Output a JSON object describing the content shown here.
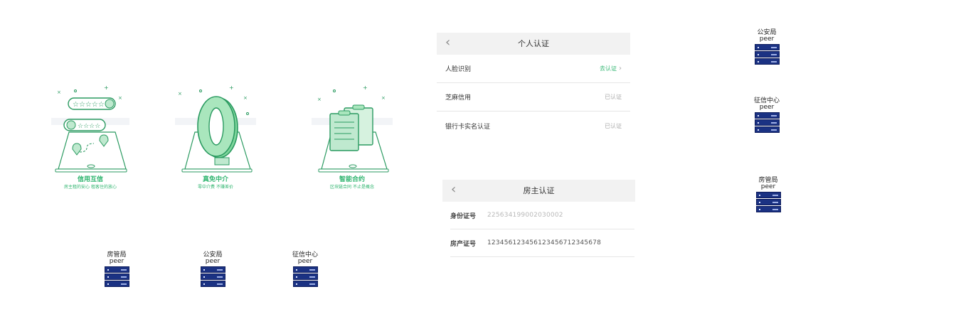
{
  "onboarding": [
    {
      "title": "信用互信",
      "subtitle": "房主租的安心    租客住的放心"
    },
    {
      "title": "真免中介",
      "subtitle": "零中介费    不赚差价"
    },
    {
      "title": "智能合约",
      "subtitle": "区块链合同    不止是概念"
    }
  ],
  "peers_row": [
    {
      "name": "房管局",
      "label": "peer"
    },
    {
      "name": "公安局",
      "label": "peer"
    },
    {
      "name": "征信中心",
      "label": "peer"
    }
  ],
  "peers_column": [
    {
      "name": "公安局",
      "label": "peer"
    },
    {
      "name": "征信中心",
      "label": "peer"
    },
    {
      "name": "房管局",
      "label": "peer"
    }
  ],
  "personal_auth": {
    "title": "个人认证",
    "rows": [
      {
        "label": "人脸识别",
        "status": "去认证"
      },
      {
        "label": "芝麻信用",
        "status": "已认证"
      },
      {
        "label": "银行卡实名认证",
        "status": "已认证"
      }
    ]
  },
  "owner_auth": {
    "title": "房主认证",
    "rows": [
      {
        "label": "身份证号",
        "value": "225634199002030002"
      },
      {
        "label": "房产证号",
        "value": "123456123456123456712345678"
      }
    ]
  },
  "colors": {
    "brand_green": "#2fb56f",
    "server_blue": "#1b3283"
  }
}
